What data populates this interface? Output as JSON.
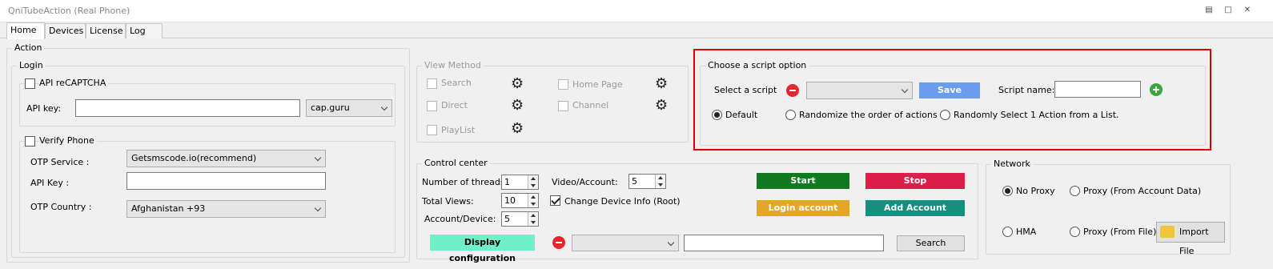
{
  "window": {
    "title": "QniTubeAction (Real Phone)"
  },
  "tabs": [
    "Home",
    "Devices",
    "License",
    "Log"
  ],
  "action": {
    "label": "Action",
    "login": {
      "label": "Login",
      "recaptcha": {
        "label": "API reCAPTCHA",
        "checked": false,
        "api_key_label": "API key:",
        "api_key_value": "",
        "provider": "cap.guru"
      },
      "verify_phone": {
        "label": "Verify Phone",
        "checked": false,
        "otp_service_label": "OTP Service :",
        "otp_service_value": "Getsmscode.io(recommend)",
        "api_key_label": "API Key :",
        "api_key_value": "",
        "otp_country_label": "OTP Country :",
        "otp_country_value": "Afghanistan +93"
      }
    }
  },
  "view_method": {
    "label": "View Method",
    "options": [
      {
        "label": "Search"
      },
      {
        "label": "Direct"
      },
      {
        "label": "PlayList"
      },
      {
        "label": "Home Page"
      },
      {
        "label": "Channel"
      }
    ]
  },
  "script_option": {
    "label": "Choose a script option",
    "select_label": "Select a script",
    "select_value": "",
    "save_label": "Save",
    "script_name_label": "Script name:",
    "script_name_value": "",
    "modes": [
      {
        "label": "Default",
        "selected": true
      },
      {
        "label": "Randomize the order of actions",
        "selected": false
      },
      {
        "label": "Randomly Select 1 Action from a List.",
        "selected": false
      }
    ]
  },
  "control_center": {
    "label": "Control center",
    "threads_label": "Number of threads:",
    "threads_value": "1",
    "total_views_label": "Total Views:",
    "total_views_value": "10",
    "account_device_label": "Account/Device:",
    "account_device_value": "5",
    "video_account_label": "Video/Account:",
    "video_account_value": "5",
    "change_device_label": "Change Device Info (Root)",
    "change_device_checked": true,
    "start_label": "Start",
    "stop_label": "Stop",
    "login_account_label": "Login account",
    "add_account_label": "Add Account",
    "display_config_label": "Display configuration",
    "config_select_value": "",
    "search_input_value": "",
    "search_label": "Search"
  },
  "network": {
    "label": "Network",
    "no_proxy_label": "No Proxy",
    "proxy_account_label": "Proxy (From Account Data)",
    "hma_label": "HMA",
    "proxy_file_label": "Proxy (From File)",
    "import_file_label": "Import File",
    "selected": "No Proxy"
  },
  "colors": {
    "start": "#0f7a1f",
    "stop": "#dc1f4a",
    "login_account": "#e3a627",
    "add_account": "#158f7f",
    "display_config": "#6ff0c8",
    "save": "#6a9cf0",
    "highlight": "#e00000"
  }
}
